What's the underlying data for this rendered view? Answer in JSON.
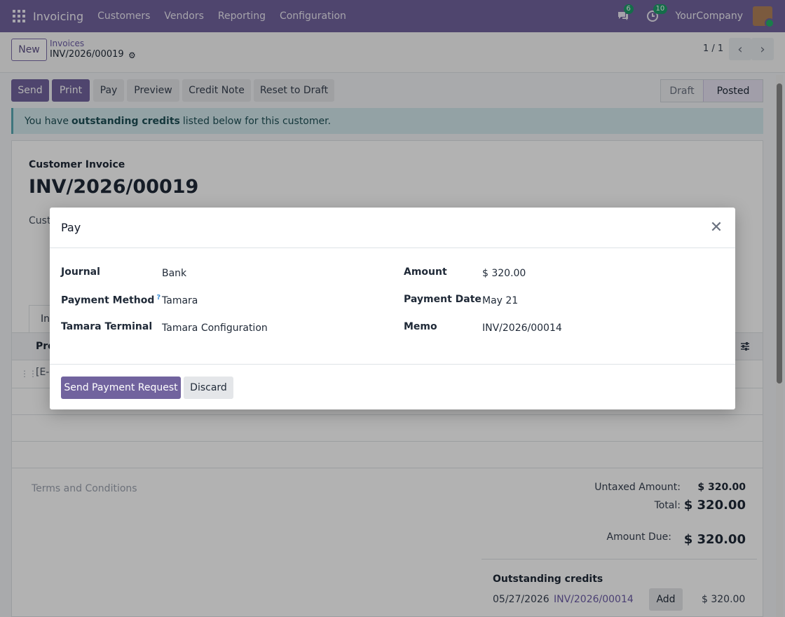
{
  "navbar": {
    "app_name": "Invoicing",
    "menu": [
      "Customers",
      "Vendors",
      "Reporting",
      "Configuration"
    ],
    "messages_count": "6",
    "activities_count": "10",
    "company": "YourCompany",
    "accent_color": "#71639e"
  },
  "control_panel": {
    "new_label": "New",
    "breadcrumb_parent": "Invoices",
    "breadcrumb_current": "INV/2026/00019",
    "pager": "1 / 1"
  },
  "actions": {
    "send": "Send",
    "print": "Print",
    "pay": "Pay",
    "preview": "Preview",
    "credit_note": "Credit Note",
    "reset_to_draft": "Reset to Draft"
  },
  "status": {
    "draft": "Draft",
    "posted": "Posted"
  },
  "alert": {
    "prefix": "You have",
    "highlight": "outstanding credits",
    "suffix": "listed below for this customer."
  },
  "invoice": {
    "type": "Customer Invoice",
    "number": "INV/2026/00019",
    "customer_label_partial": "Cust",
    "tab_partial": "Inv",
    "column_partial": "Pro",
    "line_partial": "[E-C",
    "terms_placeholder": "Terms and Conditions"
  },
  "totals": {
    "untaxed_label": "Untaxed Amount:",
    "untaxed_value": "$ 320.00",
    "total_label": "Total:",
    "total_value": "$ 320.00",
    "amount_due_label": "Amount Due:",
    "amount_due_value": "$ 320.00"
  },
  "outstanding": {
    "title": "Outstanding credits",
    "date": "05/27/2026",
    "reference": "INV/2026/00014",
    "add_label": "Add",
    "amount": "$ 320.00"
  },
  "modal": {
    "title": "Pay",
    "fields_left": [
      {
        "label": "Journal",
        "value": "Bank"
      },
      {
        "label": "Payment Method",
        "value": "Tamara"
      },
      {
        "label": "Tamara Terminal",
        "value": "Tamara Configuration"
      }
    ],
    "fields_right": [
      {
        "label": "Amount",
        "value": "$ 320.00"
      },
      {
        "label": "Payment Date",
        "value": "May 21"
      },
      {
        "label": "Memo",
        "value": "INV/2026/00014"
      }
    ],
    "help_mark": "?",
    "send_request_label": "Send Payment Request",
    "discard_label": "Discard"
  }
}
